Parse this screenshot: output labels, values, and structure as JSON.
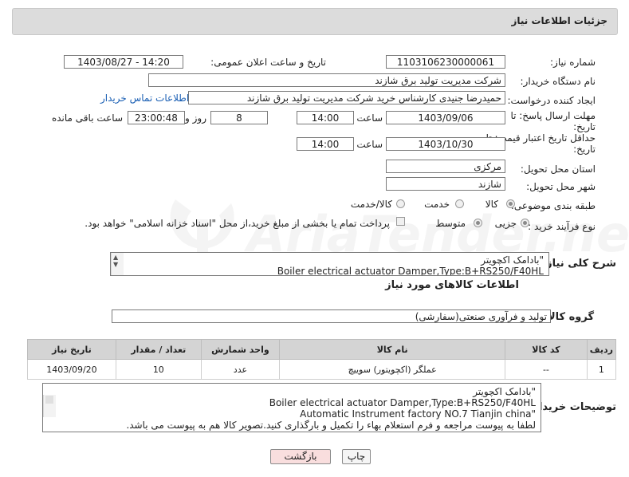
{
  "header": {
    "title": "جزئیات اطلاعات نیاز"
  },
  "form": {
    "need_number_label": "شماره نیاز:",
    "need_number": "1103106230000061",
    "announce_label": "تاریخ و ساعت اعلان عمومی:",
    "announce_value": "1403/08/27 - 14:20",
    "buyer_org_label": "نام دستگاه خریدار:",
    "buyer_org": "شرکت مدیریت تولید برق شازند",
    "requester_label": "ایجاد کننده درخواست:",
    "requester": "حمیدرضا جنیدی کارشناس خرید شرکت مدیریت تولید برق شازند",
    "contact_link": "اطلاعات تماس خریدار",
    "deadline_label_1": "مهلت ارسال پاسخ: تا",
    "deadline_label_2": "تاریخ:",
    "deadline_date": "1403/09/06",
    "time_label": "ساعت",
    "deadline_time": "14:00",
    "days_value": "8",
    "days_label": "روز و",
    "remaining_time": "23:00:48",
    "remaining_label": "ساعت باقی مانده",
    "validity_label_1": "حداقل تاریخ اعتبار قیمت: تا",
    "validity_label_2": "تاریخ:",
    "validity_date": "1403/10/30",
    "validity_time": "14:00",
    "province_label": "استان محل تحویل:",
    "province": "مرکزی",
    "city_label": "شهر محل تحویل:",
    "city": "شازند",
    "category_label": "طبقه بندی موضوعی:",
    "category_options": [
      "کالا",
      "خدمت",
      "کالا/خدمت"
    ],
    "process_label": "نوع فرآیند خرید :",
    "process_options": [
      "جزیی",
      "متوسط"
    ],
    "payment_note": "پرداخت تمام یا بخشی از مبلغ خرید،از محل \"اسناد خزانه اسلامی\" خواهد بود.",
    "summary_label": "شرح کلی نیاز:",
    "summary_line1": "\"بادامک اکچویتر",
    "summary_line2": "Boiler electrical actuator Damper,Type:B+RS250/F40HL"
  },
  "goods": {
    "section_title": "اطلاعات کالاهای مورد نیاز",
    "group_label": "گروه کالا:",
    "group_value": "تولید و فرآوری صنعتی(سفارشی)",
    "columns": [
      "ردیف",
      "کد کالا",
      "نام کالا",
      "واحد شمارش",
      "تعداد / مقدار",
      "تاریخ نیاز"
    ],
    "rows": [
      {
        "row": "1",
        "code": "--",
        "name": "عملگر (اکچویتور) سوییچ",
        "unit": "عدد",
        "qty": "10",
        "date": "1403/09/20"
      }
    ]
  },
  "buyer_notes": {
    "label": "توضیحات خریدار:",
    "line1": "\"بادامک اکچویتر",
    "line2": "Boiler electrical actuator Damper,Type:B+RS250/F40HL",
    "line3": "\"Automatic Instrument factory NO.7 Tianjin china",
    "line4": "لطفا به پیوست مراجعه و فرم استعلام بهاء را تکمیل و بارگذاری کنید.تصویر کالا هم به پیوست می باشد."
  },
  "buttons": {
    "print": "چاپ",
    "back": "بازگشت"
  },
  "colors": {
    "header_bg": "#dcdcdc",
    "link": "#1a5fb4",
    "back_button": "#f9dede"
  }
}
